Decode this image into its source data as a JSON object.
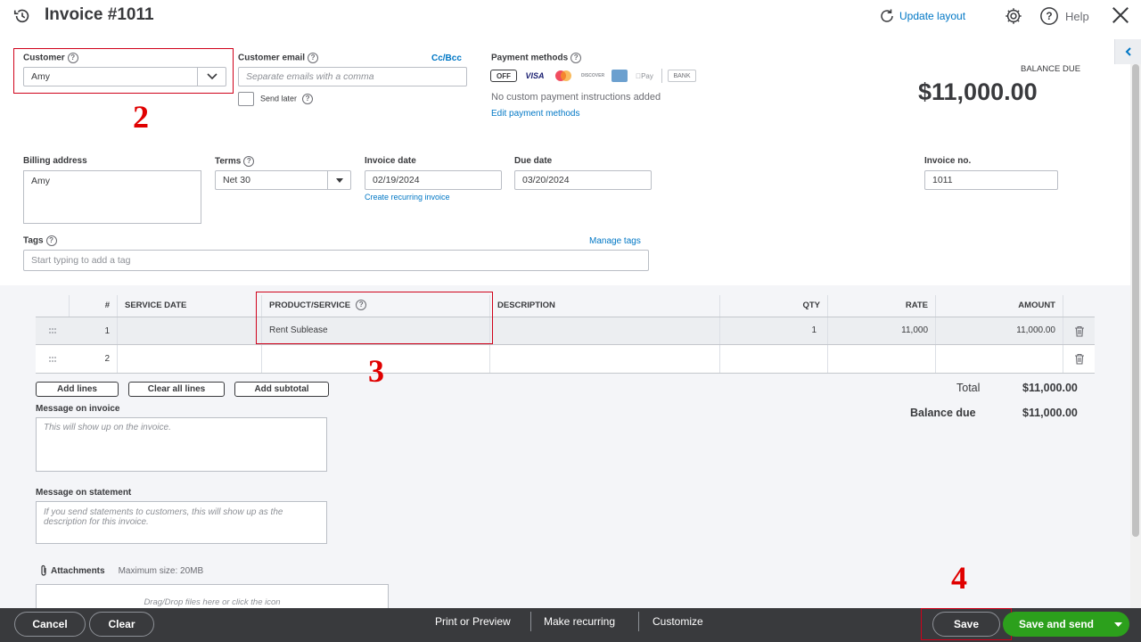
{
  "header": {
    "title": "Invoice #1011",
    "update_layout": "Update layout",
    "help": "Help"
  },
  "customer": {
    "label": "Customer",
    "value": "Amy"
  },
  "email": {
    "label": "Customer email",
    "cc_bcc": "Cc/Bcc",
    "placeholder": "Separate emails with a comma",
    "send_later": "Send later"
  },
  "payment": {
    "label": "Payment methods",
    "toggle": "OFF",
    "methods": [
      "VISA",
      "DISCOVER",
      "Pay",
      "BANK"
    ],
    "note": "No custom payment instructions added",
    "edit_link": "Edit payment methods"
  },
  "balance": {
    "label": "BALANCE DUE",
    "amount": "$11,000.00"
  },
  "billing": {
    "label": "Billing address",
    "value": "Amy"
  },
  "terms": {
    "label": "Terms",
    "value": "Net 30"
  },
  "invoice_date": {
    "label": "Invoice date",
    "value": "02/19/2024",
    "recurring_link": "Create recurring invoice"
  },
  "due_date": {
    "label": "Due date",
    "value": "03/20/2024"
  },
  "invoice_no": {
    "label": "Invoice no.",
    "value": "1011"
  },
  "tags": {
    "label": "Tags",
    "manage": "Manage tags",
    "placeholder": "Start typing to add a tag"
  },
  "table": {
    "headers": {
      "num": "#",
      "service_date": "SERVICE DATE",
      "product": "PRODUCT/SERVICE",
      "description": "DESCRIPTION",
      "qty": "QTY",
      "rate": "RATE",
      "amount": "AMOUNT"
    },
    "rows": [
      {
        "num": "1",
        "service_date": "",
        "product": "Rent Sublease",
        "description": "",
        "qty": "1",
        "rate": "11,000",
        "amount": "11,000.00"
      },
      {
        "num": "2",
        "service_date": "",
        "product": "",
        "description": "",
        "qty": "",
        "rate": "",
        "amount": ""
      }
    ]
  },
  "line_buttons": {
    "add_lines": "Add lines",
    "clear_all": "Clear all lines",
    "add_subtotal": "Add subtotal"
  },
  "totals": {
    "total_label": "Total",
    "total_value": "$11,000.00",
    "balance_label": "Balance due",
    "balance_value": "$11,000.00"
  },
  "message_invoice": {
    "label": "Message on invoice",
    "placeholder": "This will show up on the invoice."
  },
  "message_statement": {
    "label": "Message on statement",
    "placeholder": "If you send statements to customers, this will show up as the description for this invoice."
  },
  "attachments": {
    "label": "Attachments",
    "max_size": "Maximum size: 20MB",
    "drop_text": "Drag/Drop files here or click the icon"
  },
  "annotations": {
    "n2": "2",
    "n3": "3",
    "n4": "4"
  },
  "footer": {
    "cancel": "Cancel",
    "clear": "Clear",
    "print_preview": "Print or Preview",
    "make_recurring": "Make recurring",
    "customize": "Customize",
    "save": "Save",
    "save_send": "Save and send"
  },
  "colors": {
    "accent_link": "#0077c5",
    "green_button": "#2ca01c",
    "footer_bg": "#393a3d",
    "annotation_red": "#e00000"
  }
}
